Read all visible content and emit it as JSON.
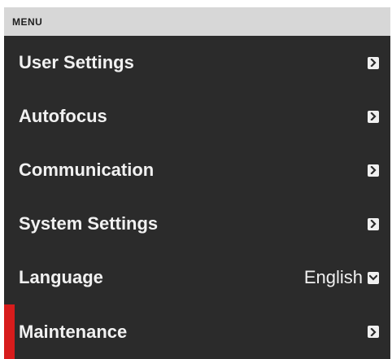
{
  "menu": {
    "header_title": "MENU",
    "items": [
      {
        "label": "User Settings",
        "icon": "chevron-right-icon"
      },
      {
        "label": "Autofocus",
        "icon": "chevron-right-icon"
      },
      {
        "label": "Communication",
        "icon": "chevron-right-icon"
      },
      {
        "label": "System Settings",
        "icon": "chevron-right-icon"
      },
      {
        "label": "Language",
        "value": "English",
        "icon": "chevron-down-icon"
      },
      {
        "label": "Maintenance",
        "icon": "chevron-right-icon",
        "selected": true
      }
    ]
  },
  "colors": {
    "panel_bg": "#2b2b2b",
    "header_bg": "#d7d7d7",
    "text": "#f1f1f1",
    "accent": "#d71c1c"
  }
}
